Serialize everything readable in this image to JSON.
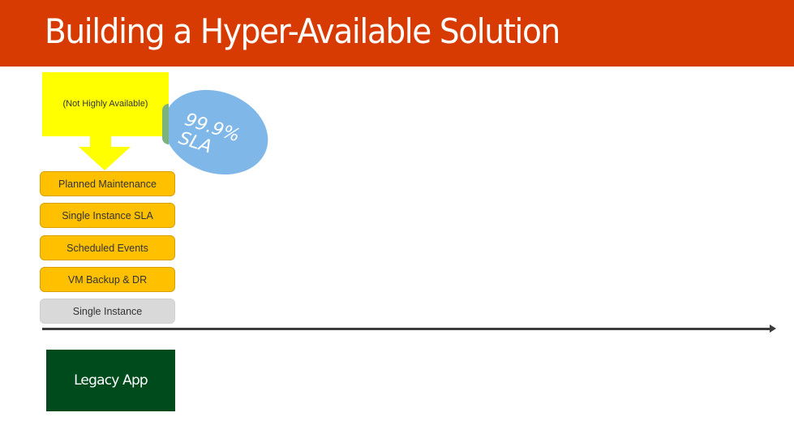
{
  "header": {
    "title": "Building a Hyper-Available Solution",
    "background_color": "#d83b01"
  },
  "callout": {
    "text": "(Not Highly Available)",
    "color": "#ffff00"
  },
  "sla_badge": {
    "line1": "99.9%",
    "line2": "SLA",
    "color": "#7fb8e8"
  },
  "stack": {
    "items": [
      {
        "label": "Planned Maintenance",
        "color": "#ffc000"
      },
      {
        "label": "Single Instance SLA",
        "color": "#ffc000"
      },
      {
        "label": "Scheduled Events",
        "color": "#ffc000"
      },
      {
        "label": "VM Backup & DR",
        "color": "#ffc000"
      },
      {
        "label": "Single Instance",
        "color": "#d9d9d9"
      }
    ]
  },
  "legacy_app": {
    "label": "Legacy App",
    "color": "#004b1c"
  }
}
